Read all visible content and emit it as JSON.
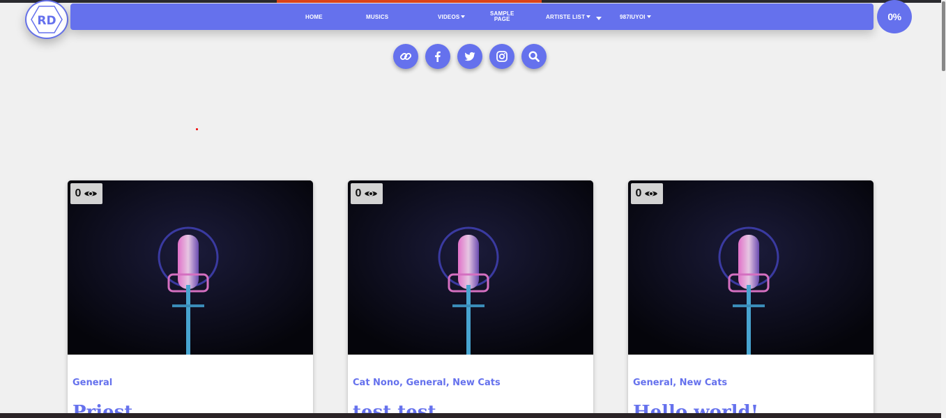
{
  "logo": {
    "text": "RD"
  },
  "nav": {
    "items": [
      {
        "label": "HOME",
        "dropdown": false
      },
      {
        "label": "MUSICS",
        "dropdown": false
      },
      {
        "label": "VIDEOS",
        "dropdown": true
      },
      {
        "label_line1": "SAMPLE",
        "label_line2": "PAGE",
        "dropdown": true
      },
      {
        "label": "ARTISTE LIST",
        "dropdown": true
      },
      {
        "label": "987IUYOI",
        "dropdown": true
      }
    ]
  },
  "progress": {
    "label": "0%",
    "value": 0
  },
  "social": [
    "link-icon",
    "facebook-icon",
    "twitter-icon",
    "instagram-icon",
    "search-icon"
  ],
  "posts": [
    {
      "views": "0",
      "categories": "General",
      "title": "Priest"
    },
    {
      "views": "0",
      "categories": "Cat Nono, General, New Cats",
      "title": "test test"
    },
    {
      "views": "0",
      "categories": "General, New Cats",
      "title": "Hello world!"
    }
  ],
  "colors": {
    "accent": "#6571ed",
    "top_accent": "#e0441a",
    "background": "#f0f0f0"
  }
}
